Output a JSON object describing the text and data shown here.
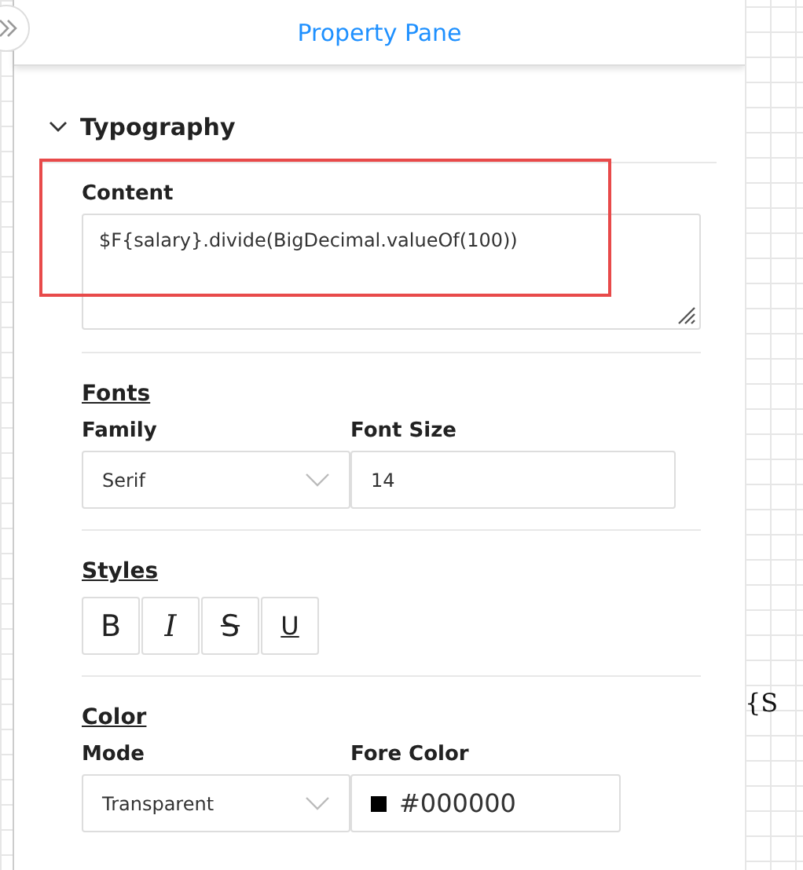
{
  "panel": {
    "title": "Property Pane"
  },
  "section": {
    "title": "Typography",
    "expanded": true,
    "content": {
      "label": "Content",
      "value": "$F{salary}.divide(BigDecimal.valueOf(100))"
    },
    "groups": [
      {
        "kind": "fields",
        "title": "Fonts",
        "fields": [
          {
            "label": "Family",
            "kind": "select",
            "value": "Serif"
          },
          {
            "label": "Font Size",
            "kind": "input",
            "value": "14"
          }
        ]
      },
      {
        "kind": "buttons",
        "title": "Styles",
        "buttons": [
          {
            "label": "B",
            "kind": "bold"
          },
          {
            "label": "I",
            "kind": "italic"
          },
          {
            "label": "S",
            "kind": "strike"
          },
          {
            "label": "U",
            "kind": "underline"
          }
        ]
      },
      {
        "kind": "fields",
        "title": "Color",
        "fields": [
          {
            "label": "Mode",
            "kind": "select",
            "value": "Transparent"
          },
          {
            "label": "Fore Color",
            "kind": "color",
            "value": "#000000",
            "color": "#000000"
          }
        ]
      }
    ]
  },
  "canvas_text": "{S"
}
